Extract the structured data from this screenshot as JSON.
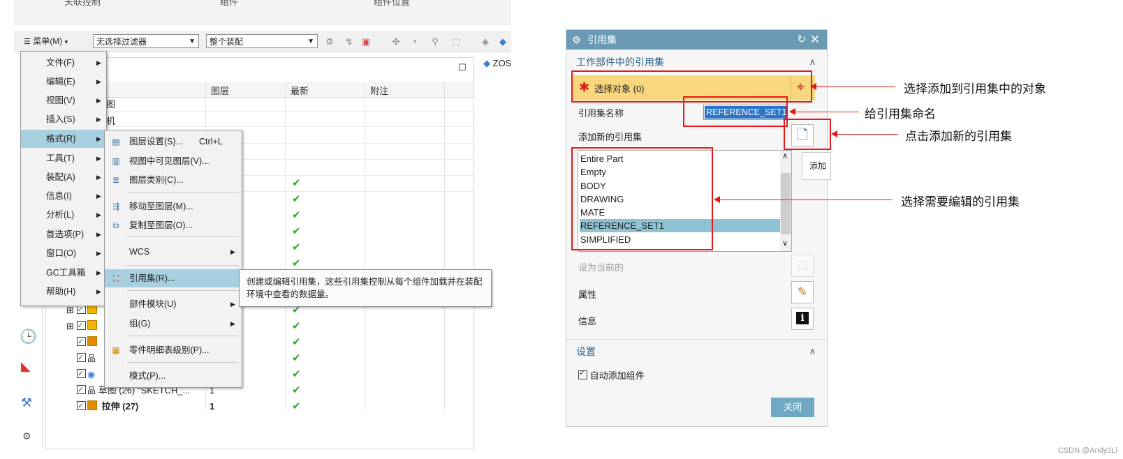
{
  "left_window": {
    "top_strip": [
      "关联控制",
      "组件",
      "组件位置"
    ],
    "toolbar": {
      "menu_label": "菜单(M)",
      "filter_select": "无选择过滤器",
      "scope_select": "整个装配"
    },
    "viewport_tab": "ZOS",
    "nav_columns": [
      "图层",
      "最新",
      "附注"
    ],
    "tree_partial": [
      "图",
      "机"
    ],
    "tree_rows": [
      {
        "label": "草图 (26) \"SKETCH_...",
        "layer": "1"
      },
      {
        "label": "拉伸 (27)",
        "layer": "1"
      }
    ],
    "main_menu": [
      {
        "label": "文件(F)"
      },
      {
        "label": "编辑(E)"
      },
      {
        "label": "视图(V)"
      },
      {
        "label": "插入(S)"
      },
      {
        "label": "格式(R)"
      },
      {
        "label": "工具(T)"
      },
      {
        "label": "装配(A)"
      },
      {
        "label": "信息(I)"
      },
      {
        "label": "分析(L)"
      },
      {
        "label": "首选项(P)"
      },
      {
        "label": "窗口(O)"
      },
      {
        "label": "GC工具箱"
      },
      {
        "label": "帮助(H)"
      }
    ],
    "format_submenu": [
      {
        "label": "图层设置(S)...",
        "shortcut": "Ctrl+L",
        "icon": "layer-settings-icon"
      },
      {
        "label": "视图中可见图层(V)...",
        "icon": "visible-layers-icon"
      },
      {
        "label": "图层类别(C)...",
        "icon": "layer-category-icon"
      },
      {
        "label": "移动至图层(M)...",
        "icon": "move-to-layer-icon"
      },
      {
        "label": "复制至图层(O)...",
        "icon": "copy-to-layer-icon"
      },
      {
        "label": "WCS"
      },
      {
        "label": "引用集(R)...",
        "icon": "reference-set-icon"
      },
      {
        "label": "部件模块(U)"
      },
      {
        "label": "组(G)"
      },
      {
        "label": "零件明细表级别(P)...",
        "icon": "parts-list-icon"
      },
      {
        "label": "模式(P)..."
      }
    ],
    "tooltip": "创建或编辑引用集，这些引用集控制从每个组件加载并在装配环境中查看的数据量。"
  },
  "dialog": {
    "title": "引用集",
    "section_work_part": "工作部件中的引用集",
    "select_object": "选择对象 (0)",
    "ref_name_label": "引用集名称",
    "ref_name_value": "REFERENCE_SET1",
    "add_new_label": "添加新的引用集",
    "add_tooltip": "添加",
    "ref_sets": [
      "Entire Part",
      "Empty",
      "BODY",
      "DRAWING",
      "MATE",
      "REFERENCE_SET1",
      "SIMPLIFIED"
    ],
    "selected_ref_set": "REFERENCE_SET1",
    "set_current_label": "设为当前的",
    "properties_label": "属性",
    "info_label": "信息",
    "section_settings": "设置",
    "auto_add_label": "自动添加组件",
    "close_label": "关闭"
  },
  "annotations": {
    "a1": "选择添加到引用集中的对象",
    "a2": "给引用集命名",
    "a3": "点击添加新的引用集",
    "a4": "选择需要编辑的引用集"
  },
  "watermark": "CSDN @Andy2Li",
  "colors": {
    "accent_red": "#e51a1a",
    "dialog_title": "#6a9ab4",
    "highlight": "#a7cfe0"
  }
}
